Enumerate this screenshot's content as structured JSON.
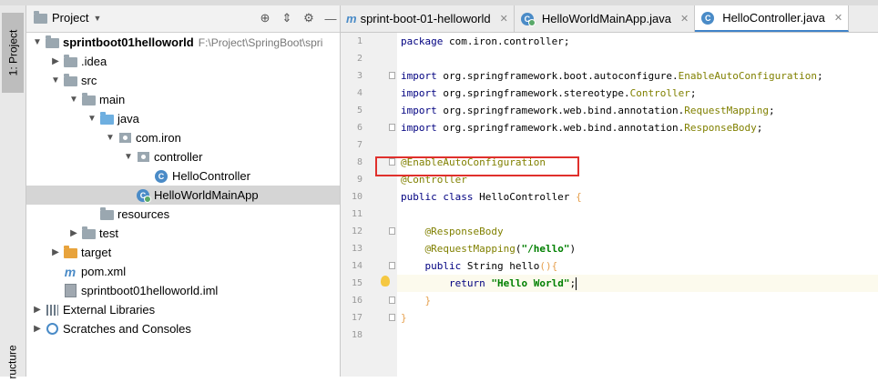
{
  "sidebar": {
    "project_tab": "1: Project",
    "structure_tab": "ructure"
  },
  "project_panel": {
    "title": "Project",
    "tree": [
      {
        "label": "sprintboot01helloworld",
        "path": "F:\\Project\\SpringBoot\\spri",
        "icon": "folder",
        "depth": 0,
        "arrow": "down",
        "bold": true
      },
      {
        "label": ".idea",
        "icon": "folder",
        "depth": 1,
        "arrow": "right"
      },
      {
        "label": "src",
        "icon": "folder",
        "depth": 1,
        "arrow": "down"
      },
      {
        "label": "main",
        "icon": "folder",
        "depth": 2,
        "arrow": "down"
      },
      {
        "label": "java",
        "icon": "folder-blue",
        "depth": 3,
        "arrow": "down"
      },
      {
        "label": "com.iron",
        "icon": "package",
        "depth": 4,
        "arrow": "down"
      },
      {
        "label": "controller",
        "icon": "package",
        "depth": 5,
        "arrow": "down"
      },
      {
        "label": "HelloController",
        "icon": "class",
        "depth": 6,
        "arrow": "none"
      },
      {
        "label": "HelloWorldMainApp",
        "icon": "class-app",
        "depth": 5,
        "arrow": "none",
        "selected": true
      },
      {
        "label": "resources",
        "icon": "folder",
        "depth": 3,
        "arrow": "none"
      },
      {
        "label": "test",
        "icon": "folder",
        "depth": 2,
        "arrow": "right"
      },
      {
        "label": "target",
        "icon": "folder-orange",
        "depth": 1,
        "arrow": "right"
      },
      {
        "label": "pom.xml",
        "icon": "maven",
        "depth": 1,
        "arrow": "none"
      },
      {
        "label": "sprintboot01helloworld.iml",
        "icon": "iml",
        "depth": 1,
        "arrow": "none"
      },
      {
        "label": "External Libraries",
        "icon": "library",
        "depth": 0,
        "arrow": "right"
      },
      {
        "label": "Scratches and Consoles",
        "icon": "scratch",
        "depth": 0,
        "arrow": "right"
      }
    ]
  },
  "editor": {
    "tabs": [
      {
        "label": "sprint-boot-01-helloworld",
        "icon": "maven",
        "active": false
      },
      {
        "label": "HelloWorldMainApp.java",
        "icon": "class-app",
        "active": false
      },
      {
        "label": "HelloController.java",
        "icon": "class",
        "active": true
      }
    ],
    "lines": [
      {
        "n": "1",
        "segs": [
          [
            "kw",
            "package "
          ],
          [
            "",
            "com.iron.controller;"
          ]
        ]
      },
      {
        "n": "2",
        "segs": []
      },
      {
        "n": "3",
        "fold": true,
        "segs": [
          [
            "kw",
            "import "
          ],
          [
            "",
            "org.springframework.boot.autoconfigure."
          ],
          [
            "ty",
            "EnableAutoConfiguration"
          ],
          [
            "",
            ";"
          ]
        ]
      },
      {
        "n": "4",
        "segs": [
          [
            "kw",
            "import "
          ],
          [
            "",
            "org.springframework.stereotype."
          ],
          [
            "ty",
            "Controller"
          ],
          [
            "",
            ";"
          ]
        ]
      },
      {
        "n": "5",
        "segs": [
          [
            "kw",
            "import "
          ],
          [
            "",
            "org.springframework.web.bind.annotation."
          ],
          [
            "ty",
            "RequestMapping"
          ],
          [
            "",
            ";"
          ]
        ]
      },
      {
        "n": "6",
        "fold": true,
        "segs": [
          [
            "kw",
            "import "
          ],
          [
            "",
            "org.springframework.web.bind.annotation."
          ],
          [
            "ty",
            "ResponseBody"
          ],
          [
            "",
            ";"
          ]
        ]
      },
      {
        "n": "7",
        "segs": []
      },
      {
        "n": "8",
        "fold": true,
        "segs": [
          [
            "an",
            "@EnableAutoConfiguration"
          ]
        ]
      },
      {
        "n": "9",
        "segs": [
          [
            "an",
            "@Controller"
          ]
        ]
      },
      {
        "n": "10",
        "segs": [
          [
            "kw",
            "public class "
          ],
          [
            "",
            "HelloController "
          ],
          [
            "br",
            "{"
          ]
        ]
      },
      {
        "n": "11",
        "segs": []
      },
      {
        "n": "12",
        "fold": true,
        "segs": [
          [
            "",
            "    "
          ],
          [
            "an",
            "@ResponseBody"
          ]
        ]
      },
      {
        "n": "13",
        "segs": [
          [
            "",
            "    "
          ],
          [
            "an",
            "@RequestMapping"
          ],
          [
            "",
            "("
          ],
          [
            "st",
            "\"/hello\""
          ],
          [
            "",
            ")"
          ]
        ]
      },
      {
        "n": "14",
        "fold": true,
        "segs": [
          [
            "",
            "    "
          ],
          [
            "kw",
            "public "
          ],
          [
            "",
            "String hello"
          ],
          [
            "br",
            "(){"
          ]
        ]
      },
      {
        "n": "15",
        "current": true,
        "bulb": true,
        "caret": true,
        "segs": [
          [
            "",
            "        "
          ],
          [
            "kw",
            "return "
          ],
          [
            "st",
            "\"Hello World\""
          ],
          [
            "",
            ";"
          ]
        ]
      },
      {
        "n": "16",
        "fold": true,
        "segs": [
          [
            "",
            "    "
          ],
          [
            "br",
            "}"
          ]
        ]
      },
      {
        "n": "17",
        "fold": true,
        "segs": [
          [
            "br",
            "}"
          ]
        ]
      },
      {
        "n": "18",
        "segs": []
      }
    ]
  },
  "colors": {
    "highlight_box": "#e0302c",
    "keyword": "#000080",
    "annotation": "#808000",
    "string": "#008000"
  }
}
